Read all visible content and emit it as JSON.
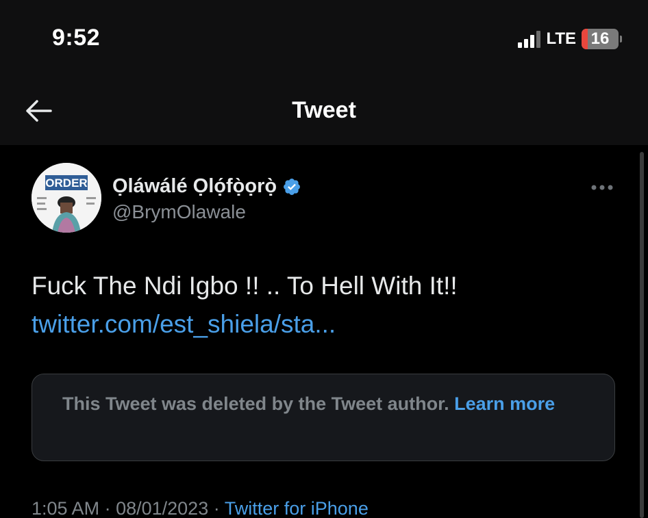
{
  "status_bar": {
    "time": "9:52",
    "network": "LTE",
    "battery_level": "16",
    "battery_color": "#e8473d",
    "signal_icon": "cellular-signal-icon"
  },
  "header": {
    "title": "Tweet",
    "back_icon": "back-arrow-icon"
  },
  "tweet": {
    "author_name": "Ọláwálé Ọlọ́fọ̀ọrọ̀",
    "author_handle": "@BrymOlawale",
    "verified_icon": "verified-badge-icon",
    "more_icon": "more-options-icon",
    "avatar_label": "ORDER",
    "text": "Fuck The Ndi Igbo !! .. To Hell With It!!",
    "link_text": "twitter.com/est_shiela/sta...",
    "deleted_notice": {
      "text": "This Tweet was deleted by the Tweet author.",
      "link_text": "Learn more"
    },
    "time": "1:05 AM",
    "date": "08/01/2023",
    "source": "Twitter for iPhone"
  },
  "colors": {
    "accent": "#4a9fe8",
    "verified": "#4a9fe8",
    "background": "#000000"
  }
}
